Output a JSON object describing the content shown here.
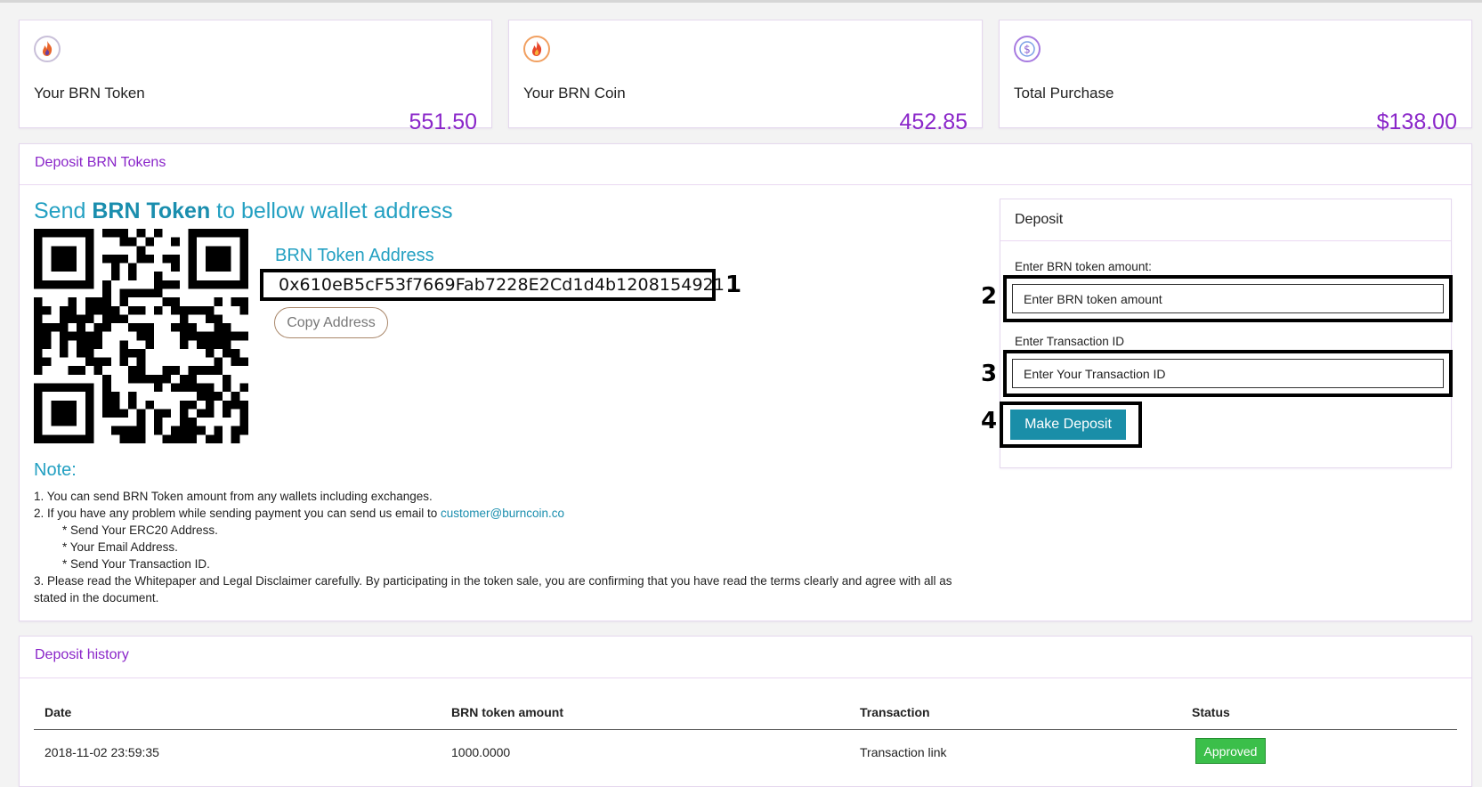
{
  "stats": [
    {
      "label": "Your BRN Token",
      "value": "551.50",
      "icon": "flame-icon"
    },
    {
      "label": "Your BRN Coin",
      "value": "452.85",
      "icon": "flame-icon"
    },
    {
      "label": "Total Purchase",
      "value": "$138.00",
      "icon": "dollar-icon"
    }
  ],
  "deposit_section": {
    "title": "Deposit BRN Tokens",
    "heading_pre": "Send ",
    "heading_bold": "BRN Token",
    "heading_post": " to bellow wallet address",
    "address_label": "BRN Token Address",
    "address": "0x610eB5cF53f7669Fab7228E2Cd1d4b1208154921",
    "copy_label": "Copy Address",
    "note_title": "Note:",
    "notes": {
      "n1": "1. You can send BRN Token amount from any wallets including exchanges.",
      "n2": "2. If you have any problem while sending payment you can send us email to ",
      "email": "customer@burncoin.co",
      "s1": "* Send Your ERC20 Address.",
      "s2": "* Your Email Address.",
      "s3": "* Send Your Transaction ID.",
      "n3": "3. Please read the Whitepaper and Legal Disclaimer carefully. By participating in the token sale, you are confirming that you have read the terms clearly and agree with all as stated in the document."
    }
  },
  "deposit_form": {
    "title": "Deposit",
    "amount_label": "Enter BRN token amount:",
    "amount_placeholder": "Enter BRN token amount",
    "tx_label": "Enter Transaction ID",
    "tx_placeholder": "Enter Your Transaction ID",
    "button": "Make Deposit"
  },
  "annotations": [
    "1",
    "2",
    "3",
    "4"
  ],
  "history": {
    "title": "Deposit history",
    "columns": [
      "Date",
      "BRN token amount",
      "Transaction",
      "Status"
    ],
    "rows": [
      {
        "date": "2018-11-02 23:59:35",
        "amount": "1000.0000",
        "transaction": "Transaction link",
        "status": "Approved"
      }
    ]
  },
  "colors": {
    "accent": "#8a26c9",
    "teal": "#23a0c2",
    "button": "#1a8ea8",
    "approved": "#3bbf4a"
  }
}
